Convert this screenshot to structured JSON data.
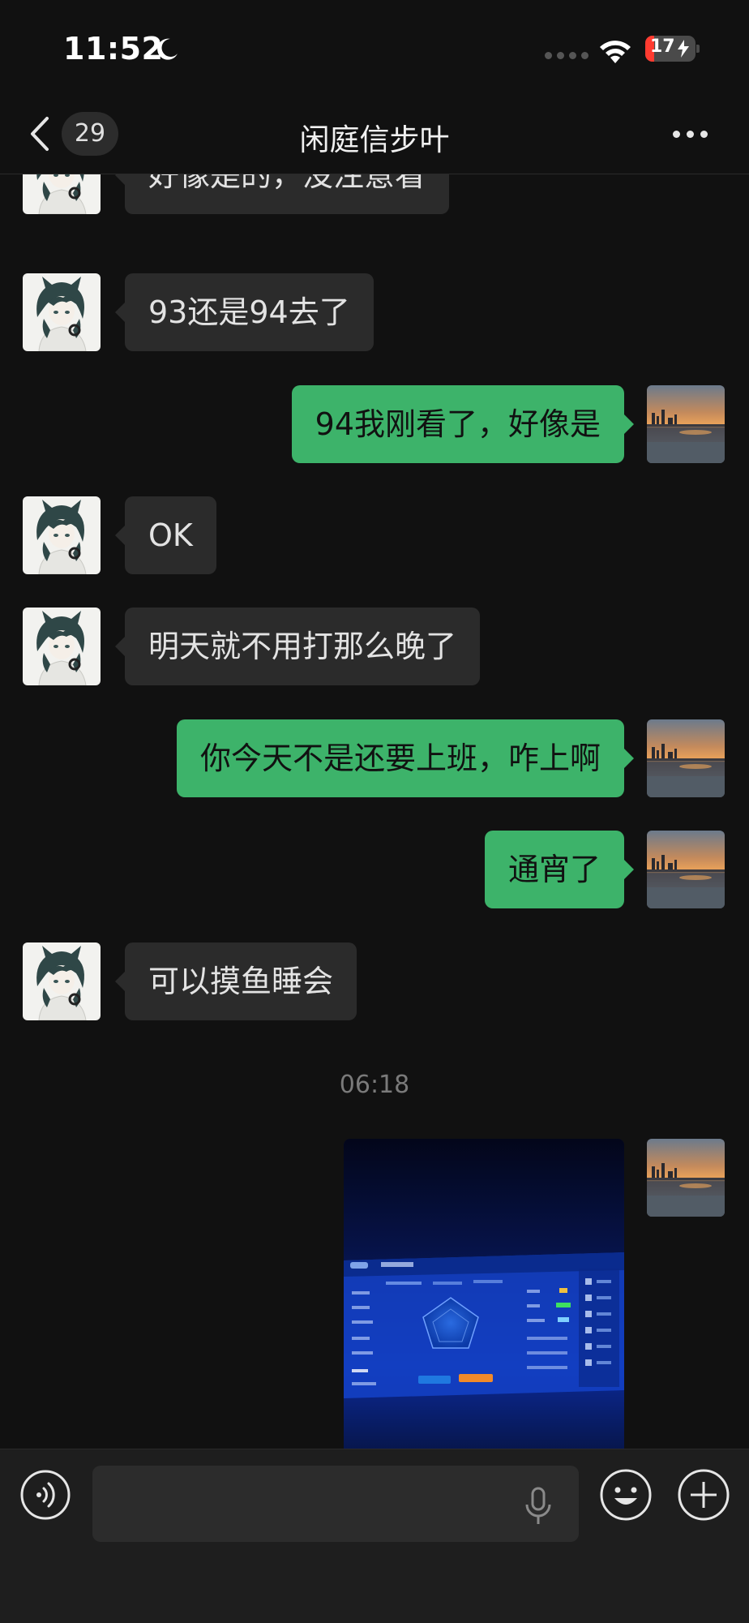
{
  "status_bar": {
    "time": "11:52",
    "focus_icon": "moon-icon",
    "signal_icon": "cellular-dots-icon",
    "wifi_icon": "wifi-icon",
    "battery_level": "17",
    "battery_color": "#ff3b30",
    "battery_charging_icon": "bolt-icon"
  },
  "nav": {
    "back_icon": "chevron-left-icon",
    "unread_count": "29",
    "title": "闲庭信步叶",
    "more_icon": "more-dots-icon"
  },
  "messages": [
    {
      "side": "in",
      "text": "好像是的，没注意看"
    },
    {
      "side": "in",
      "text": "93还是94去了"
    },
    {
      "side": "out",
      "text": "94我刚看了，好像是"
    },
    {
      "side": "in",
      "text": "OK"
    },
    {
      "side": "in",
      "text": "明天就不用打那么晚了"
    },
    {
      "side": "out",
      "text": "你今天不是还要上班，咋上啊"
    },
    {
      "side": "out",
      "text": "通宵了"
    },
    {
      "side": "in",
      "text": "可以摸鱼睡会"
    }
  ],
  "timestamp": "06:18",
  "photo_message": {
    "side": "out",
    "content": "photo of a game stats screen"
  },
  "input_bar": {
    "voice_icon": "voice-mode-icon",
    "input_value": "",
    "mic_icon": "microphone-icon",
    "emoji_icon": "emoji-icon",
    "plus_icon": "plus-icon"
  },
  "colors": {
    "background": "#111111",
    "incoming_bubble": "#2b2b2b",
    "outgoing_bubble": "#3db36a"
  }
}
